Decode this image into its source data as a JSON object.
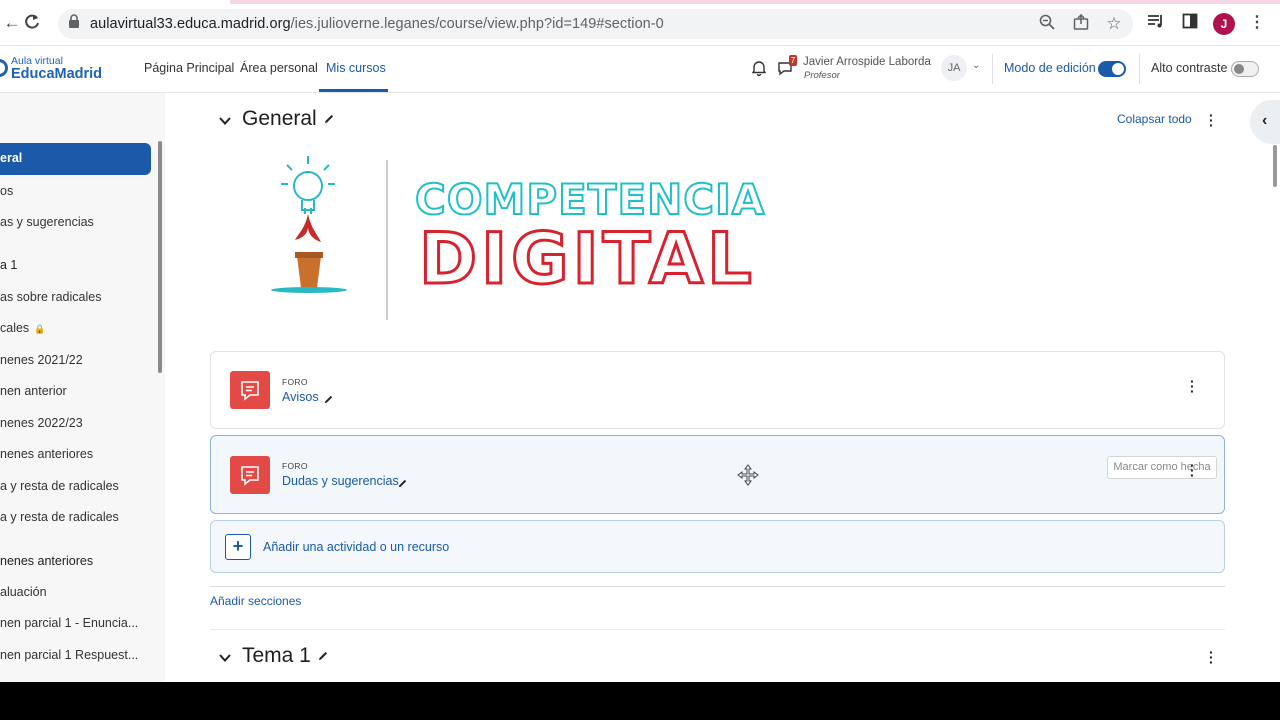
{
  "browser": {
    "url_host": "aulavirtual33.educa.madrid.org",
    "url_path": "/ies.julioverne.leganes/course/view.php?id=149#section-0",
    "profile_initial": "J"
  },
  "navbar": {
    "logo_small": "Aula virtual",
    "logo_big": "EducaMadrid",
    "links": [
      "Página Principal",
      "Área personal",
      "Mis cursos"
    ],
    "message_count": "7",
    "user_name": "Javier Arrospide Laborda",
    "user_role": "Profesor",
    "user_initials": "JA",
    "edit_mode_label": "Modo de edición",
    "edit_mode_on": true,
    "contrast_label": "Alto contraste",
    "contrast_on": false
  },
  "sidebar": {
    "active": "eral",
    "items": [
      "os",
      "as y sugerencias",
      "a 1",
      "as sobre radicales",
      "cales",
      "nenes 2021/22",
      "nen anterior",
      "nenes 2022/23",
      "nenes anteriores",
      "a y resta de radicales",
      "a y resta de radicales",
      "nenes anteriores",
      "aluación",
      "nen parcial 1 - Enuncia...",
      "nen parcial 1 Respuest..."
    ]
  },
  "main": {
    "section_general": "General",
    "collapse_all": "Colapsar todo",
    "banner": {
      "line1": "COMPETENCIA",
      "line2": "DIGITAL"
    },
    "activities": [
      {
        "type": "FORO",
        "name": "Avisos"
      },
      {
        "type": "FORO",
        "name": "Dudas y sugerencias",
        "completion": "Marcar como hecha"
      }
    ],
    "add_activity": "Añadir una actividad o un recurso",
    "add_sections": "Añadir secciones",
    "section_tema1": "Tema 1"
  }
}
